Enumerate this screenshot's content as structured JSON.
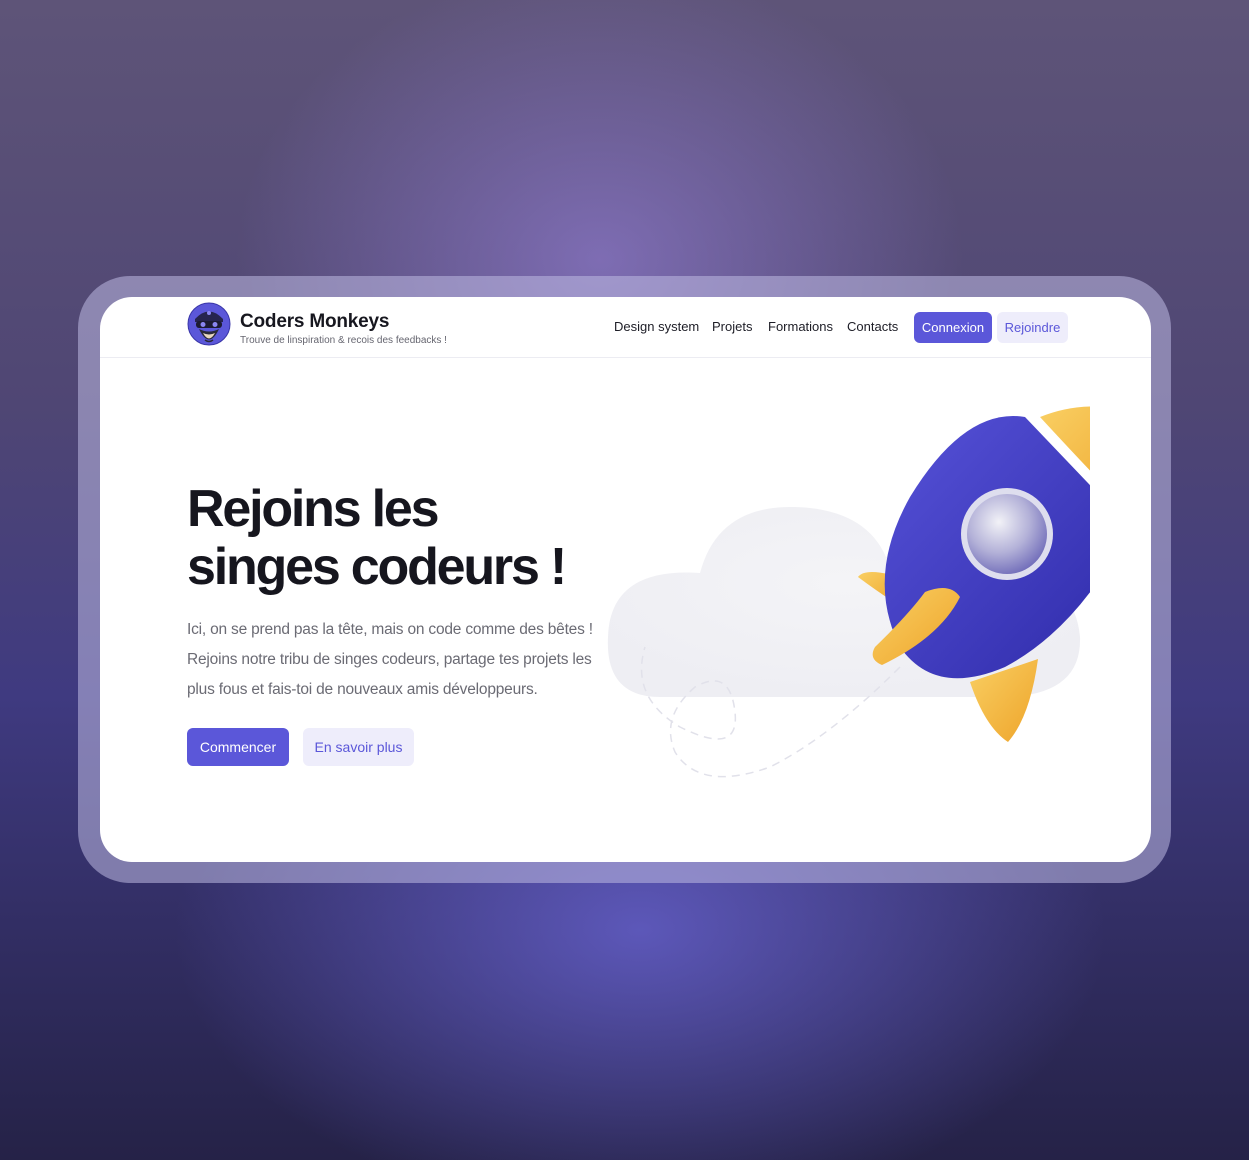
{
  "brand": {
    "name": "Coders Monkeys",
    "tagline": "Trouve de linspiration & recois des feedbacks !"
  },
  "nav": {
    "links": [
      {
        "label": "Design system"
      },
      {
        "label": "Projets"
      },
      {
        "label": "Formations"
      },
      {
        "label": "Contacts"
      }
    ],
    "login_label": "Connexion",
    "join_label": "Rejoindre"
  },
  "hero": {
    "title_line1": "Rejoins les",
    "title_line2": "singes codeurs !",
    "text_line1": "Ici, on se prend pas la tête, mais on code comme des bêtes !",
    "text_line2": "Rejoins notre tribu de singes codeurs, partage tes projets les",
    "text_line3": "plus fous et fais-toi de nouveaux amis développeurs.",
    "primary_cta": "Commencer",
    "secondary_cta": "En savoir plus"
  },
  "colors": {
    "accent": "#5b57d9",
    "accent_soft": "#eeedfb",
    "rocket_body": "#3f3bc4",
    "rocket_fins": "#f6b73c"
  },
  "icons": {
    "logo": "monkey-avatar-icon",
    "illustration": "rocket-illustration"
  }
}
